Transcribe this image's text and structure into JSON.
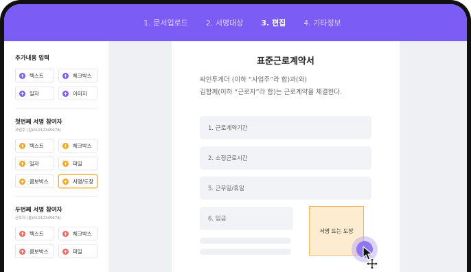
{
  "steps": [
    {
      "label": "1. 문서업로드"
    },
    {
      "label": "2. 서명대상"
    },
    {
      "label": "3. 편집",
      "active": true
    },
    {
      "label": "4. 기타정보"
    }
  ],
  "sidebar": {
    "add_content": {
      "title": "추가내용 입력",
      "items": [
        "텍스트",
        "체크박스",
        "일자",
        "이미지"
      ]
    },
    "first_signer": {
      "title": "첫번째 서명 참여자",
      "subtitle": "사업주 (김)01012345678)",
      "items": [
        "텍스트",
        "체크박스",
        "일자",
        "파일",
        "콤보박스",
        "서명/도장"
      ]
    },
    "second_signer": {
      "title": "두번째 서명 참여자",
      "subtitle": "근로자 (을)01012345678)",
      "items": [
        "텍스트",
        "체크박스",
        "콤보박스",
        "파일"
      ]
    }
  },
  "document": {
    "title": "표준근로계약서",
    "intro_line1": "싸인투게더 (이하 “사업주”라 함)과(와)",
    "intro_line2": "김함께(이하 “근로자”라 함)는 근로계약을 체결한다.",
    "fields": [
      "1. 근로계약기간",
      "2. 소정근로시간",
      "5. 근무일/휴일",
      "6. 임금"
    ],
    "signature_box_label": "서명 또는 도장"
  },
  "colors": {
    "brand": "#7b5cf5",
    "signer1": "#f5a623",
    "signer2": "#ef6b63",
    "signature_fill": "#fdecd0"
  },
  "icons": [
    "plus-icon",
    "cursor-arrow-icon",
    "move-icon"
  ]
}
